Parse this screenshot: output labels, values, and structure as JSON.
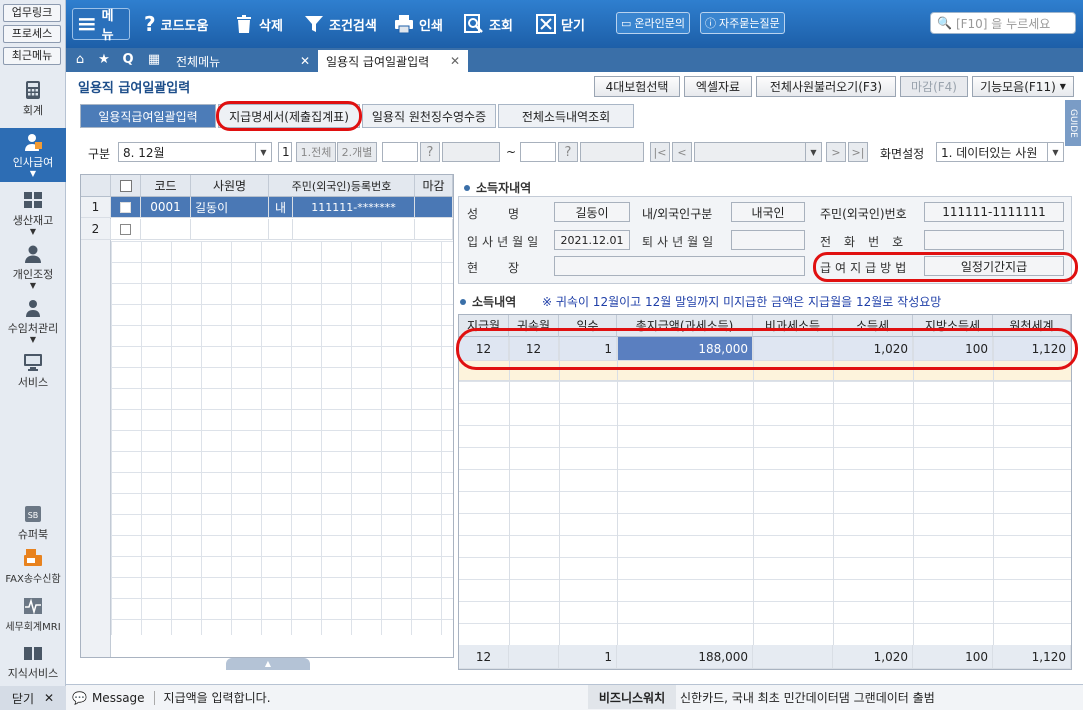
{
  "sidebar": {
    "quick_links": [
      "업무링크",
      "프로세스",
      "최근메뉴"
    ],
    "items": [
      {
        "label": "회계",
        "icon": "calculator-icon"
      },
      {
        "label": "인사급여",
        "icon": "person-icon"
      },
      {
        "label": "생산재고",
        "icon": "grid-icon"
      },
      {
        "label": "개인조정",
        "icon": "user-icon"
      },
      {
        "label": "수임처관리",
        "icon": "people-icon"
      },
      {
        "label": "서비스",
        "icon": "monitor-icon"
      }
    ],
    "tools": [
      {
        "label": "슈퍼북",
        "icon": "sb-icon"
      },
      {
        "label": "FAX송수신함",
        "icon": "fax-icon"
      },
      {
        "label": "세무회계MRI",
        "icon": "pulse-icon"
      },
      {
        "label": "지식서비스",
        "icon": "book-icon"
      }
    ],
    "close_label": "닫기"
  },
  "toolbar": {
    "menu": "메뉴",
    "code_help": "코드도움",
    "delete": "삭제",
    "condition_search": "조건검색",
    "print": "인쇄",
    "lookup": "조회",
    "close": "닫기",
    "online_inquiry": "온라인문의",
    "faq": "자주묻는질문",
    "search_placeholder": "[F10] 을 누르세요"
  },
  "tabs": {
    "all_menu": "전체메뉴",
    "current": "일용직 급여일괄입력"
  },
  "page": {
    "title": "일용직 급여일괄입력",
    "buttons": {
      "insurance": "4대보험선택",
      "excel": "엑셀자료",
      "load_all": "전체사원불러오기(F3)",
      "closing": "마감(F4)",
      "functions": "기능모음(F11)"
    },
    "guide": "GUIDE"
  },
  "subtabs": [
    "일용직급여일괄입력",
    "지급명세서(제출집계표)",
    "일용직 원천징수영수증",
    "전체소득내역조회"
  ],
  "filter": {
    "gubun_label": "구분",
    "gubun_value": "8. 12월",
    "num_value": "1",
    "btn_all": "1.전체",
    "btn_each": "2.개별",
    "tilde": "~",
    "screen_setting_label": "화면설정",
    "screen_setting_value": "1. 데이터있는 사원"
  },
  "employee_grid": {
    "columns": [
      "",
      "코드",
      "사원명",
      "주민(외국인)등록번호",
      "마감"
    ],
    "rows": [
      {
        "num": "1",
        "code": "0001",
        "name": "길동이",
        "type": "내",
        "resident_no": "111111-*******",
        "closed": ""
      },
      {
        "num": "2",
        "code": "",
        "name": "",
        "type": "",
        "resident_no": "",
        "closed": ""
      }
    ]
  },
  "income_earner": {
    "section_title": "소득자내역",
    "name_label": "성명",
    "name_value": "길동이",
    "nationality_label": "내/외국인구분",
    "nationality_value": "내국인",
    "resident_label": "주민(외국인)번호",
    "resident_value": "111111-1111111",
    "hire_label": "입사년월일",
    "hire_value": "2021.12.01",
    "leave_label": "퇴사년월일",
    "leave_value": "",
    "phone_label": "전화번호",
    "phone_value": "",
    "site_label": "현장",
    "site_value": "",
    "pay_method_label": "급여지급방법",
    "pay_method_value": "일정기간지급"
  },
  "income_detail": {
    "section_title": "소득내역",
    "note": "※ 귀속이 12월이고 12월 말일까지 미지급한 금액은 지급월을 12월로 작성요망",
    "columns": [
      "지급월",
      "귀속월",
      "일수",
      "총지급액(과세소득)",
      "비과세소득",
      "소득세",
      "지방소득세",
      "원천세계"
    ],
    "rows": [
      [
        "12",
        "12",
        "1",
        "188,000",
        "",
        "1,020",
        "100",
        "1,120"
      ]
    ],
    "totals": [
      "12",
      "",
      "1",
      "188,000",
      "",
      "1,020",
      "100",
      "1,120"
    ]
  },
  "status": {
    "message_label": "Message",
    "message_text": "지급액을 입력합니다.",
    "bizwatch_label": "비즈니스워치",
    "news": "신한카드, 국내 최초 민간데이터댐 그랜데이터 출범"
  }
}
